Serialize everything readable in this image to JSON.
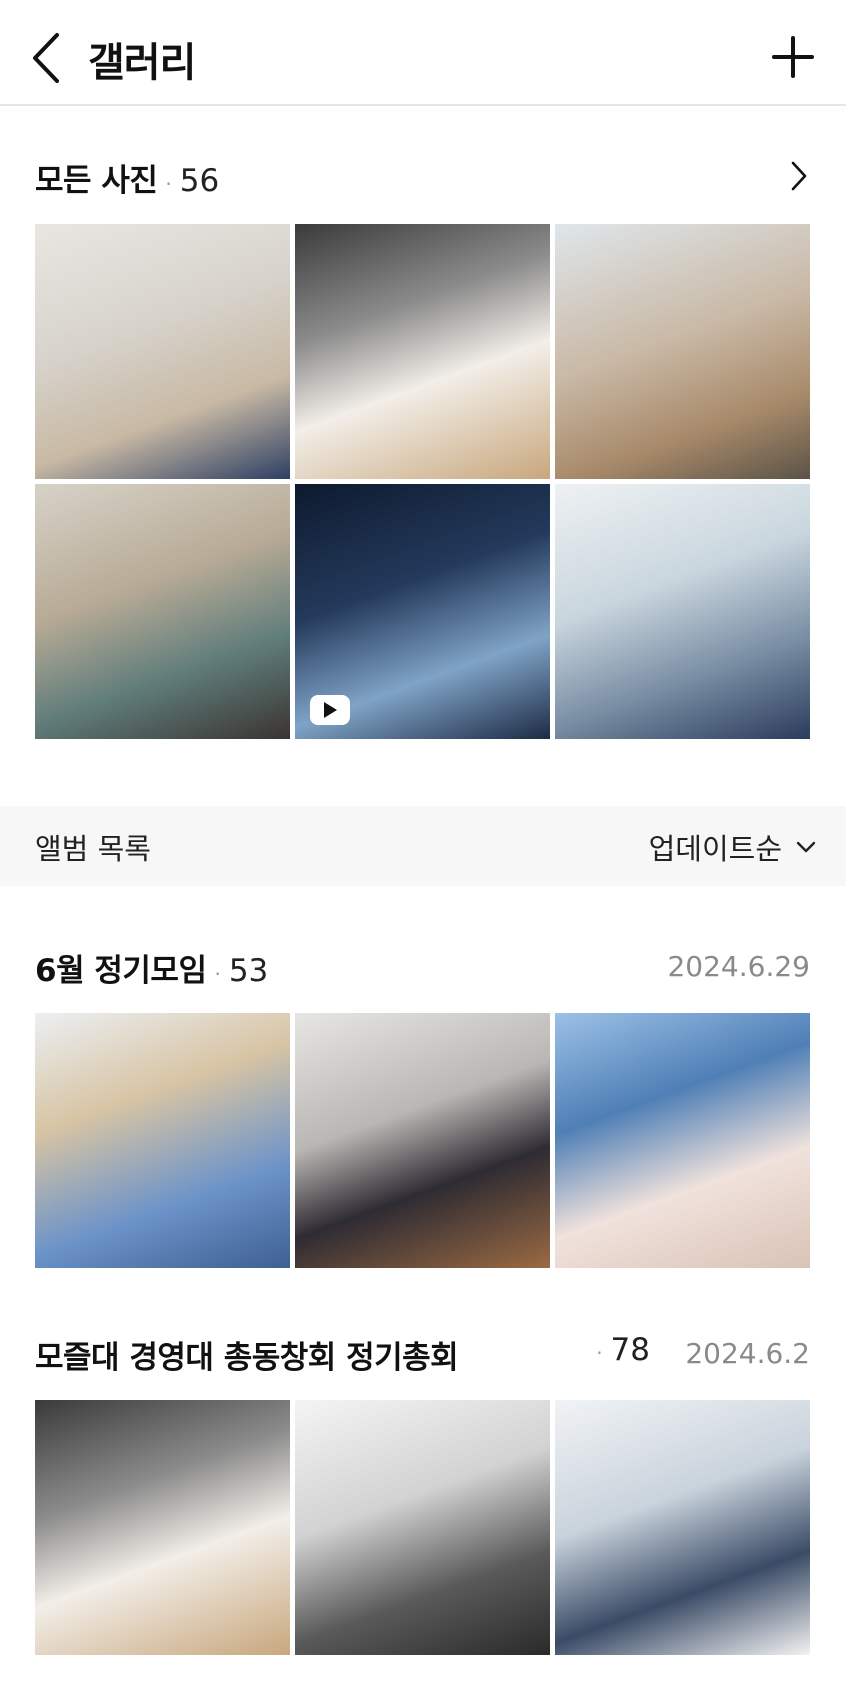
{
  "header": {
    "title": "갤러리"
  },
  "all_photos": {
    "title": "모든 사진",
    "count": "56",
    "photos": [
      {
        "alt": "사진 1"
      },
      {
        "alt": "사진 2"
      },
      {
        "alt": "사진 3"
      },
      {
        "alt": "사진 4"
      },
      {
        "alt": "동영상 5",
        "is_video": true
      },
      {
        "alt": "사진 6"
      }
    ]
  },
  "album_bar": {
    "label": "앨범 목록",
    "sort_label": "업데이트순"
  },
  "albums": [
    {
      "title": "6월 정기모임",
      "count": "53",
      "date": "2024.6.29"
    },
    {
      "title": "모즐대 경영대 총동창회 정기총회",
      "count": "78",
      "date": "2024.6.2"
    }
  ]
}
